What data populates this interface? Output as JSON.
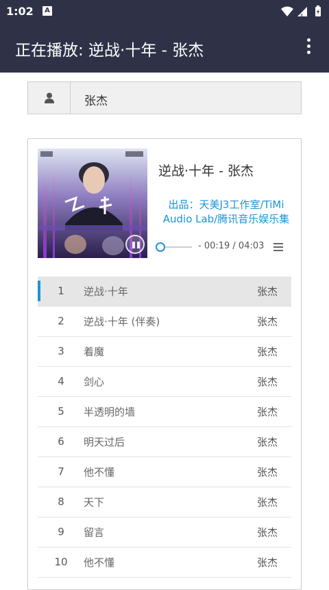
{
  "status_bar": {
    "time": "1:02",
    "notification_badge": "A"
  },
  "app_bar": {
    "title": "正在播放: 逆战·十年 - 张杰"
  },
  "search": {
    "value": "张杰"
  },
  "now_playing": {
    "song_title": "逆战·十年 - 张杰",
    "producer_line1": "出品：天美J3工作室/TiMi",
    "producer_line2": "Audio Lab/腾讯音乐娱乐集",
    "time_display": "- 00:19 / 04:03",
    "progress_fraction": 0.08
  },
  "tracks": [
    {
      "num": "1",
      "title": "逆战·十年",
      "artist": "张杰",
      "active": true
    },
    {
      "num": "2",
      "title": "逆战·十年 (伴奏)",
      "artist": "张杰"
    },
    {
      "num": "3",
      "title": "着魔",
      "artist": "张杰"
    },
    {
      "num": "4",
      "title": "剑心",
      "artist": "张杰"
    },
    {
      "num": "5",
      "title": "半透明的墙",
      "artist": "张杰"
    },
    {
      "num": "6",
      "title": "明天过后",
      "artist": "张杰"
    },
    {
      "num": "7",
      "title": "他不懂",
      "artist": "张杰"
    },
    {
      "num": "8",
      "title": "天下",
      "artist": "张杰"
    },
    {
      "num": "9",
      "title": "留言",
      "artist": "张杰"
    },
    {
      "num": "10",
      "title": "他不懂",
      "artist": "张杰"
    }
  ],
  "colors": {
    "app_bar": "#2f3247",
    "accent": "#1a95d5"
  }
}
